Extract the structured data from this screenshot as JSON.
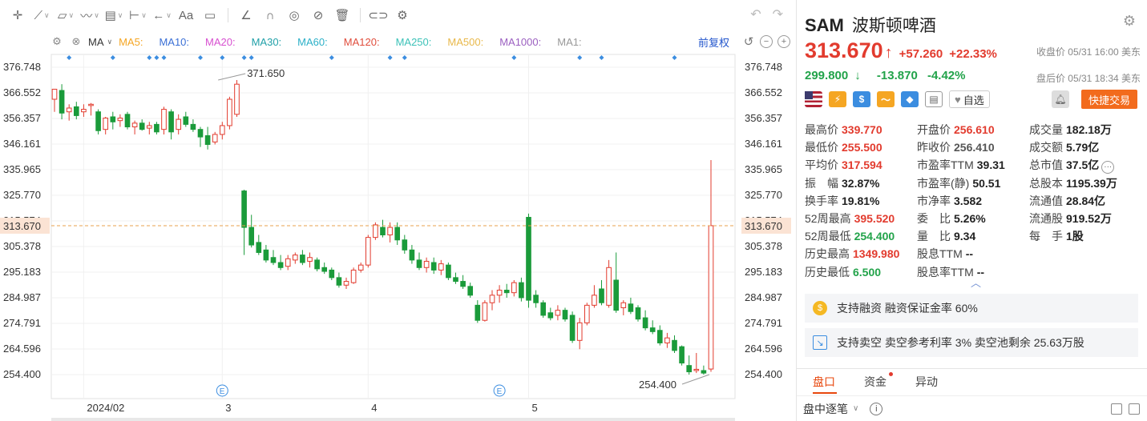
{
  "toolbar": {
    "icons": [
      "crosshair-icon",
      "line-tool-icon",
      "shape-tool-icon",
      "wave-tool-icon",
      "fib-tool-icon",
      "measure-tool-icon",
      "arrow-tool-icon",
      "text-tool-icon",
      "comment-tool-icon",
      "ruler-icon",
      "magnet-icon",
      "eye-icon",
      "hide-icon",
      "trash-icon",
      "link-icon",
      "settings-icon",
      "undo-icon",
      "redo-icon"
    ],
    "text_tool_label": "Aa"
  },
  "ma_bar": {
    "selected": "MA",
    "items": [
      {
        "label": "MA5:",
        "color": "#f5a623"
      },
      {
        "label": "MA10:",
        "color": "#3a6fd6"
      },
      {
        "label": "MA20:",
        "color": "#d74fd0"
      },
      {
        "label": "MA30:",
        "color": "#20a0a8"
      },
      {
        "label": "MA60:",
        "color": "#2bb0c8"
      },
      {
        "label": "MA120:",
        "color": "#e04d3c"
      },
      {
        "label": "MA250:",
        "color": "#3cc2b8"
      },
      {
        "label": "MA500:",
        "color": "#e8b84a"
      },
      {
        "label": "MA1000:",
        "color": "#9b5fc0"
      },
      {
        "label": "MA1:",
        "color": "#999999"
      }
    ],
    "adjust_label": "前复权"
  },
  "chart_data": {
    "type": "candlestick",
    "y_ticks": [
      "376.748",
      "366.552",
      "356.357",
      "346.161",
      "335.965",
      "325.770",
      "315.574",
      "305.378",
      "295.183",
      "284.987",
      "274.791",
      "264.596",
      "254.400"
    ],
    "y_tick_values": [
      376.748,
      366.552,
      356.357,
      346.161,
      335.965,
      325.77,
      315.574,
      305.378,
      295.183,
      284.987,
      274.791,
      264.596,
      254.4
    ],
    "ylim": [
      254.4,
      376.748
    ],
    "x_labels": [
      {
        "label": "2024/02",
        "index": 4
      },
      {
        "label": "3",
        "index": 23
      },
      {
        "label": "4",
        "index": 43
      },
      {
        "label": "5",
        "index": 65
      }
    ],
    "current_price": "313.670",
    "current_price_value": 313.67,
    "max_annotation": {
      "label": "371.650",
      "value": 371.65,
      "index": 22
    },
    "min_annotation": {
      "label": "254.400",
      "value": 254.4,
      "index": 90
    },
    "earnings_markers": [
      23,
      61
    ],
    "dividend_markers": [
      2,
      8,
      13,
      14,
      15,
      20,
      23,
      26,
      27,
      38,
      46,
      48,
      63,
      72,
      75,
      85
    ],
    "candles": [
      {
        "o": 364.0,
        "h": 367.0,
        "l": 359.0,
        "c": 368.0
      },
      {
        "o": 367.5,
        "h": 370.0,
        "l": 356.0,
        "c": 358.5
      },
      {
        "o": 359.0,
        "h": 362.0,
        "l": 355.5,
        "c": 360.5
      },
      {
        "o": 361.0,
        "h": 363.0,
        "l": 356.0,
        "c": 357.5
      },
      {
        "o": 359.0,
        "h": 362.0,
        "l": 357.0,
        "c": 360.0
      },
      {
        "o": 361.5,
        "h": 362.5,
        "l": 357.5,
        "c": 362.0
      },
      {
        "o": 359.0,
        "h": 360.0,
        "l": 350.0,
        "c": 351.5
      },
      {
        "o": 352.0,
        "h": 357.0,
        "l": 350.0,
        "c": 356.5
      },
      {
        "o": 357.0,
        "h": 359.0,
        "l": 352.0,
        "c": 355.0
      },
      {
        "o": 355.5,
        "h": 358.0,
        "l": 353.0,
        "c": 356.5
      },
      {
        "o": 358.0,
        "h": 359.0,
        "l": 352.0,
        "c": 353.0
      },
      {
        "o": 353.0,
        "h": 355.5,
        "l": 350.0,
        "c": 354.5
      },
      {
        "o": 354.5,
        "h": 356.0,
        "l": 351.5,
        "c": 352.0
      },
      {
        "o": 352.5,
        "h": 355.0,
        "l": 350.0,
        "c": 353.5
      },
      {
        "o": 354.0,
        "h": 355.0,
        "l": 350.0,
        "c": 351.0
      },
      {
        "o": 352.0,
        "h": 361.0,
        "l": 350.0,
        "c": 360.0
      },
      {
        "o": 359.0,
        "h": 360.0,
        "l": 348.0,
        "c": 351.0
      },
      {
        "o": 352.0,
        "h": 358.0,
        "l": 350.0,
        "c": 356.0
      },
      {
        "o": 357.0,
        "h": 359.0,
        "l": 353.0,
        "c": 354.0
      },
      {
        "o": 354.0,
        "h": 356.0,
        "l": 351.0,
        "c": 352.0
      },
      {
        "o": 352.0,
        "h": 353.0,
        "l": 345.0,
        "c": 349.0
      },
      {
        "o": 349.5,
        "h": 353.0,
        "l": 344.0,
        "c": 346.0
      },
      {
        "o": 347.0,
        "h": 351.0,
        "l": 346.0,
        "c": 350.0
      },
      {
        "o": 350.0,
        "h": 355.0,
        "l": 348.0,
        "c": 353.5
      },
      {
        "o": 353.5,
        "h": 365.0,
        "l": 352.0,
        "c": 364.0
      },
      {
        "o": 358.0,
        "h": 371.65,
        "l": 357.0,
        "c": 370.0
      },
      {
        "o": 327.5,
        "h": 328.0,
        "l": 302.0,
        "c": 313.0
      },
      {
        "o": 313.0,
        "h": 318.0,
        "l": 305.0,
        "c": 306.0
      },
      {
        "o": 307.0,
        "h": 310.0,
        "l": 302.0,
        "c": 303.0
      },
      {
        "o": 304.0,
        "h": 306.0,
        "l": 299.0,
        "c": 300.0
      },
      {
        "o": 301.0,
        "h": 304.0,
        "l": 298.0,
        "c": 299.0
      },
      {
        "o": 299.0,
        "h": 302.0,
        "l": 296.0,
        "c": 297.0
      },
      {
        "o": 297.5,
        "h": 302.0,
        "l": 296.0,
        "c": 300.5
      },
      {
        "o": 300.0,
        "h": 303.0,
        "l": 298.5,
        "c": 302.0
      },
      {
        "o": 302.0,
        "h": 304.0,
        "l": 298.0,
        "c": 299.0
      },
      {
        "o": 299.5,
        "h": 303.0,
        "l": 297.0,
        "c": 301.0
      },
      {
        "o": 300.0,
        "h": 301.0,
        "l": 295.5,
        "c": 296.5
      },
      {
        "o": 297.0,
        "h": 299.0,
        "l": 294.5,
        "c": 295.5
      },
      {
        "o": 296.0,
        "h": 297.0,
        "l": 292.0,
        "c": 293.0
      },
      {
        "o": 293.0,
        "h": 295.0,
        "l": 289.0,
        "c": 290.0
      },
      {
        "o": 290.0,
        "h": 293.0,
        "l": 288.5,
        "c": 291.5
      },
      {
        "o": 291.0,
        "h": 297.0,
        "l": 290.5,
        "c": 296.0
      },
      {
        "o": 296.0,
        "h": 299.0,
        "l": 295.0,
        "c": 298.0
      },
      {
        "o": 298.0,
        "h": 310.0,
        "l": 297.0,
        "c": 309.0
      },
      {
        "o": 309.0,
        "h": 315.0,
        "l": 308.0,
        "c": 314.0
      },
      {
        "o": 313.0,
        "h": 316.0,
        "l": 309.0,
        "c": 310.0
      },
      {
        "o": 310.0,
        "h": 315.0,
        "l": 307.0,
        "c": 313.0
      },
      {
        "o": 313.0,
        "h": 315.0,
        "l": 306.0,
        "c": 308.0
      },
      {
        "o": 308.0,
        "h": 310.0,
        "l": 302.5,
        "c": 304.0
      },
      {
        "o": 304.0,
        "h": 306.0,
        "l": 298.5,
        "c": 300.0
      },
      {
        "o": 300.0,
        "h": 303.0,
        "l": 296.0,
        "c": 297.0
      },
      {
        "o": 297.0,
        "h": 301.0,
        "l": 295.0,
        "c": 299.5
      },
      {
        "o": 299.0,
        "h": 301.0,
        "l": 294.5,
        "c": 296.0
      },
      {
        "o": 296.0,
        "h": 300.0,
        "l": 294.0,
        "c": 298.5
      },
      {
        "o": 298.0,
        "h": 299.0,
        "l": 292.0,
        "c": 293.0
      },
      {
        "o": 293.0,
        "h": 295.0,
        "l": 290.5,
        "c": 291.5
      },
      {
        "o": 291.5,
        "h": 294.0,
        "l": 288.5,
        "c": 289.5
      },
      {
        "o": 289.5,
        "h": 291.0,
        "l": 285.0,
        "c": 286.0
      },
      {
        "o": 282.0,
        "h": 284.0,
        "l": 275.0,
        "c": 276.0
      },
      {
        "o": 276.0,
        "h": 284.0,
        "l": 275.5,
        "c": 283.0
      },
      {
        "o": 283.0,
        "h": 288.0,
        "l": 280.0,
        "c": 286.0
      },
      {
        "o": 286.0,
        "h": 290.0,
        "l": 283.0,
        "c": 288.0
      },
      {
        "o": 288.0,
        "h": 290.5,
        "l": 285.0,
        "c": 287.0
      },
      {
        "o": 287.0,
        "h": 292.0,
        "l": 285.5,
        "c": 291.0
      },
      {
        "o": 291.0,
        "h": 293.0,
        "l": 283.5,
        "c": 285.0
      },
      {
        "o": 317.0,
        "h": 318.5,
        "l": 281.0,
        "c": 284.0
      },
      {
        "o": 286.0,
        "h": 288.0,
        "l": 281.0,
        "c": 283.0
      },
      {
        "o": 283.0,
        "h": 284.0,
        "l": 277.0,
        "c": 278.0
      },
      {
        "o": 279.0,
        "h": 281.0,
        "l": 276.0,
        "c": 277.0
      },
      {
        "o": 278.0,
        "h": 282.0,
        "l": 276.0,
        "c": 280.0
      },
      {
        "o": 280.0,
        "h": 281.0,
        "l": 275.5,
        "c": 276.5
      },
      {
        "o": 278.0,
        "h": 279.5,
        "l": 267.0,
        "c": 268.0
      },
      {
        "o": 268.0,
        "h": 277.0,
        "l": 264.5,
        "c": 275.0
      },
      {
        "o": 275.0,
        "h": 283.0,
        "l": 274.0,
        "c": 282.0
      },
      {
        "o": 282.0,
        "h": 290.0,
        "l": 281.0,
        "c": 286.0
      },
      {
        "o": 288.5,
        "h": 292.0,
        "l": 282.0,
        "c": 283.0
      },
      {
        "o": 282.0,
        "h": 300.0,
        "l": 281.0,
        "c": 297.0
      },
      {
        "o": 292.0,
        "h": 303.0,
        "l": 279.0,
        "c": 280.0
      },
      {
        "o": 281.0,
        "h": 284.0,
        "l": 278.0,
        "c": 283.0
      },
      {
        "o": 282.5,
        "h": 285.0,
        "l": 278.5,
        "c": 279.5
      },
      {
        "o": 281.0,
        "h": 282.0,
        "l": 275.5,
        "c": 276.5
      },
      {
        "o": 277.0,
        "h": 280.0,
        "l": 272.0,
        "c": 273.0
      },
      {
        "o": 273.0,
        "h": 276.0,
        "l": 270.5,
        "c": 271.5
      },
      {
        "o": 272.0,
        "h": 274.0,
        "l": 266.0,
        "c": 267.0
      },
      {
        "o": 267.0,
        "h": 271.0,
        "l": 265.0,
        "c": 269.0
      },
      {
        "o": 268.0,
        "h": 270.0,
        "l": 263.0,
        "c": 264.0
      },
      {
        "o": 265.5,
        "h": 266.0,
        "l": 258.0,
        "c": 259.0
      },
      {
        "o": 258.0,
        "h": 262.0,
        "l": 254.4,
        "c": 255.5
      },
      {
        "o": 256.0,
        "h": 263.0,
        "l": 255.0,
        "c": 256.5
      },
      {
        "o": 256.0,
        "h": 258.0,
        "l": 254.4,
        "c": 255.0
      },
      {
        "o": 256.61,
        "h": 339.77,
        "l": 255.5,
        "c": 313.67
      }
    ],
    "up_color": "#e23b2e",
    "down_color": "#1a9b3a"
  },
  "header": {
    "ticker": "SAM",
    "name": "波斯顿啤酒",
    "price": "313.670",
    "change": "+57.260",
    "change_pct": "+22.33%",
    "close_time": "收盘价 05/31 16:00 美东",
    "after_price": "299.800",
    "after_arrow": "↓",
    "after_change": "-13.870",
    "after_change_pct": "-4.42%",
    "after_time": "盘后价 05/31 18:34 美东"
  },
  "badges": {
    "fav_label": "自选",
    "trade_label": "快捷交易"
  },
  "stats": [
    [
      {
        "label": "最高价",
        "value": "339.770",
        "tone": "red"
      },
      {
        "label": "开盘价",
        "value": "256.610",
        "tone": "red"
      },
      {
        "label": "成交量",
        "value": "182.18万",
        "tone": ""
      }
    ],
    [
      {
        "label": "最低价",
        "value": "255.500",
        "tone": "red"
      },
      {
        "label": "昨收价",
        "value": "256.410",
        "tone": "gray"
      },
      {
        "label": "成交额",
        "value": "5.79亿",
        "tone": ""
      }
    ],
    [
      {
        "label": "平均价",
        "value": "317.594",
        "tone": "red"
      },
      {
        "label": "市盈率TTM",
        "value": "39.31",
        "tone": ""
      },
      {
        "label": "总市值",
        "value": "37.5亿",
        "tone": ""
      }
    ],
    [
      {
        "label": "振　幅",
        "value": "32.87%",
        "tone": ""
      },
      {
        "label": "市盈率(静)",
        "value": "50.51",
        "tone": ""
      },
      {
        "label": "总股本",
        "value": "1195.39万",
        "tone": ""
      }
    ],
    [
      {
        "label": "换手率",
        "value": "19.81%",
        "tone": ""
      },
      {
        "label": "市净率",
        "value": "3.582",
        "tone": ""
      },
      {
        "label": "流通值",
        "value": "28.84亿",
        "tone": ""
      }
    ],
    [
      {
        "label": "52周最高",
        "value": "395.520",
        "tone": "red"
      },
      {
        "label": "委　比",
        "value": "5.26%",
        "tone": ""
      },
      {
        "label": "流通股",
        "value": "919.52万",
        "tone": ""
      }
    ],
    [
      {
        "label": "52周最低",
        "value": "254.400",
        "tone": "green"
      },
      {
        "label": "量　比",
        "value": "9.34",
        "tone": ""
      },
      {
        "label": "每　手",
        "value": "1股",
        "tone": ""
      }
    ],
    [
      {
        "label": "历史最高",
        "value": "1349.980",
        "tone": "red"
      },
      {
        "label": "股息TTM",
        "value": "--",
        "tone": ""
      },
      {
        "label": "",
        "value": "",
        "tone": ""
      }
    ],
    [
      {
        "label": "历史最低",
        "value": "6.500",
        "tone": "green"
      },
      {
        "label": "股息率TTM",
        "value": "--",
        "tone": ""
      },
      {
        "label": "",
        "value": "",
        "tone": ""
      }
    ]
  ],
  "info": {
    "margin": "支持融资 融资保证金率 60%",
    "short": "支持卖空 卖空参考利率 3% 卖空池剩余 25.63万股"
  },
  "tabs": [
    "盘口",
    "资金",
    "异动"
  ],
  "sub": {
    "label": "盘中逐笔"
  }
}
